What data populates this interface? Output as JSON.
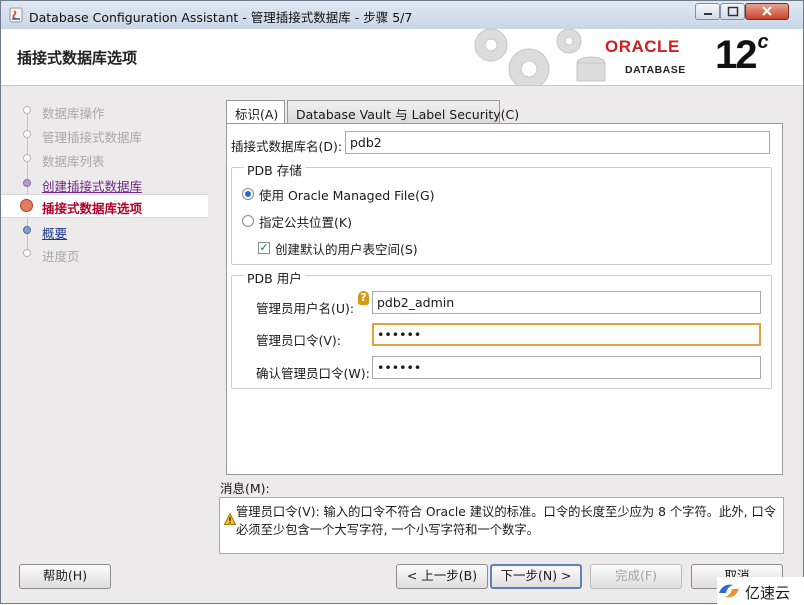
{
  "window": {
    "title": "Database Configuration Assistant - 管理插接式数据库 - 步骤 5/7"
  },
  "header": {
    "page_title": "插接式数据库选项",
    "brand": {
      "word": "ORACLE",
      "sub": "DATABASE",
      "version": "12",
      "version_suffix": "c"
    }
  },
  "nav": {
    "steps": [
      {
        "label": "数据库操作",
        "state": "disabled"
      },
      {
        "label": "管理插接式数据库",
        "state": "disabled"
      },
      {
        "label": "数据库列表",
        "state": "disabled"
      },
      {
        "label": "创建插接式数据库",
        "state": "done"
      },
      {
        "label": "插接式数据库选项",
        "state": "current"
      },
      {
        "label": "概要",
        "state": "next"
      },
      {
        "label": "进度页",
        "state": "disabled"
      }
    ]
  },
  "tabs": {
    "identifier": "标识(A)",
    "database_vault": "Database Vault 与 Label Security(C)"
  },
  "form": {
    "pdb_name_label": "插接式数据库名(D):",
    "pdb_name_value": "pdb2",
    "storage_group_title": "PDB 存储",
    "radio_omf_label": "使用 Oracle Managed File(G)",
    "radio_omf_selected": true,
    "radio_common_label": "指定公共位置(K)",
    "checkbox_tablespace_label": "创建默认的用户表空间(S)",
    "checkbox_tablespace_checked": true,
    "user_group_title": "PDB 用户",
    "admin_user_label": "管理员用户名(U):",
    "admin_user_value": "pdb2_admin",
    "admin_pwd_label": "管理员口令(V):",
    "admin_pwd_value": "••••••",
    "confirm_pwd_label": "确认管理员口令(W):",
    "confirm_pwd_value": "••••••"
  },
  "messages": {
    "label": "消息(M):",
    "text": "管理员口令(V): 输入的口令不符合 Oracle 建议的标准。口令的长度至少应为 8 个字符。此外, 口令必须至少包含一个大写字符, 一个小写字符和一个数字。",
    "icon": "warning-icon"
  },
  "buttons": {
    "help": "帮助(H)",
    "back": "< 上一步(B)",
    "next": "下一步(N) >",
    "finish": "完成(F)",
    "cancel": "取消"
  },
  "watermark": {
    "text": "亿速云"
  },
  "colors": {
    "oracle_red": "#d01e1e",
    "current_step": "#b2002a",
    "visited_step": "#6f2b88",
    "focus_border": "#e3a33c"
  }
}
